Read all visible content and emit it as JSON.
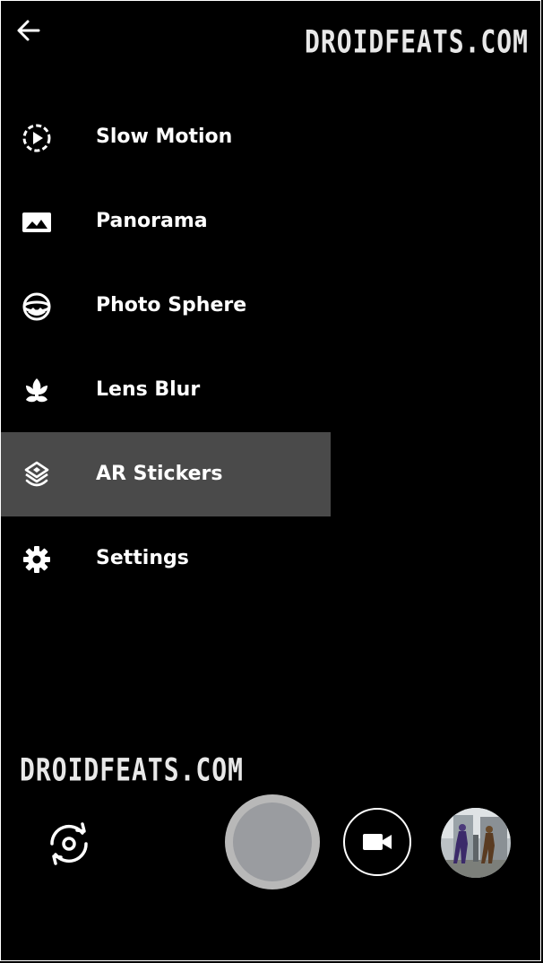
{
  "watermark": {
    "top": "DROIDFEATS.COM",
    "bottom": "DROIDFEATS.COM"
  },
  "header": {
    "back_icon": "arrow-left-icon"
  },
  "menu": {
    "items": [
      {
        "label": "Slow Motion",
        "icon": "slow-motion-icon",
        "selected": false
      },
      {
        "label": "Panorama",
        "icon": "panorama-icon",
        "selected": false
      },
      {
        "label": "Photo Sphere",
        "icon": "photo-sphere-icon",
        "selected": false
      },
      {
        "label": "Lens Blur",
        "icon": "lens-blur-icon",
        "selected": false
      },
      {
        "label": "AR Stickers",
        "icon": "ar-stickers-icon",
        "selected": true
      },
      {
        "label": "Settings",
        "icon": "gear-icon",
        "selected": false
      }
    ]
  },
  "controls": {
    "switch_camera_icon": "switch-camera-icon",
    "shutter_icon": "shutter-button",
    "video_icon": "video-camera-icon",
    "thumbnail": "gallery-thumbnail"
  },
  "colors": {
    "background": "#000000",
    "selected_row": "#4a4a4a",
    "shutter": "#9a9ca0",
    "text": "#ffffff"
  }
}
